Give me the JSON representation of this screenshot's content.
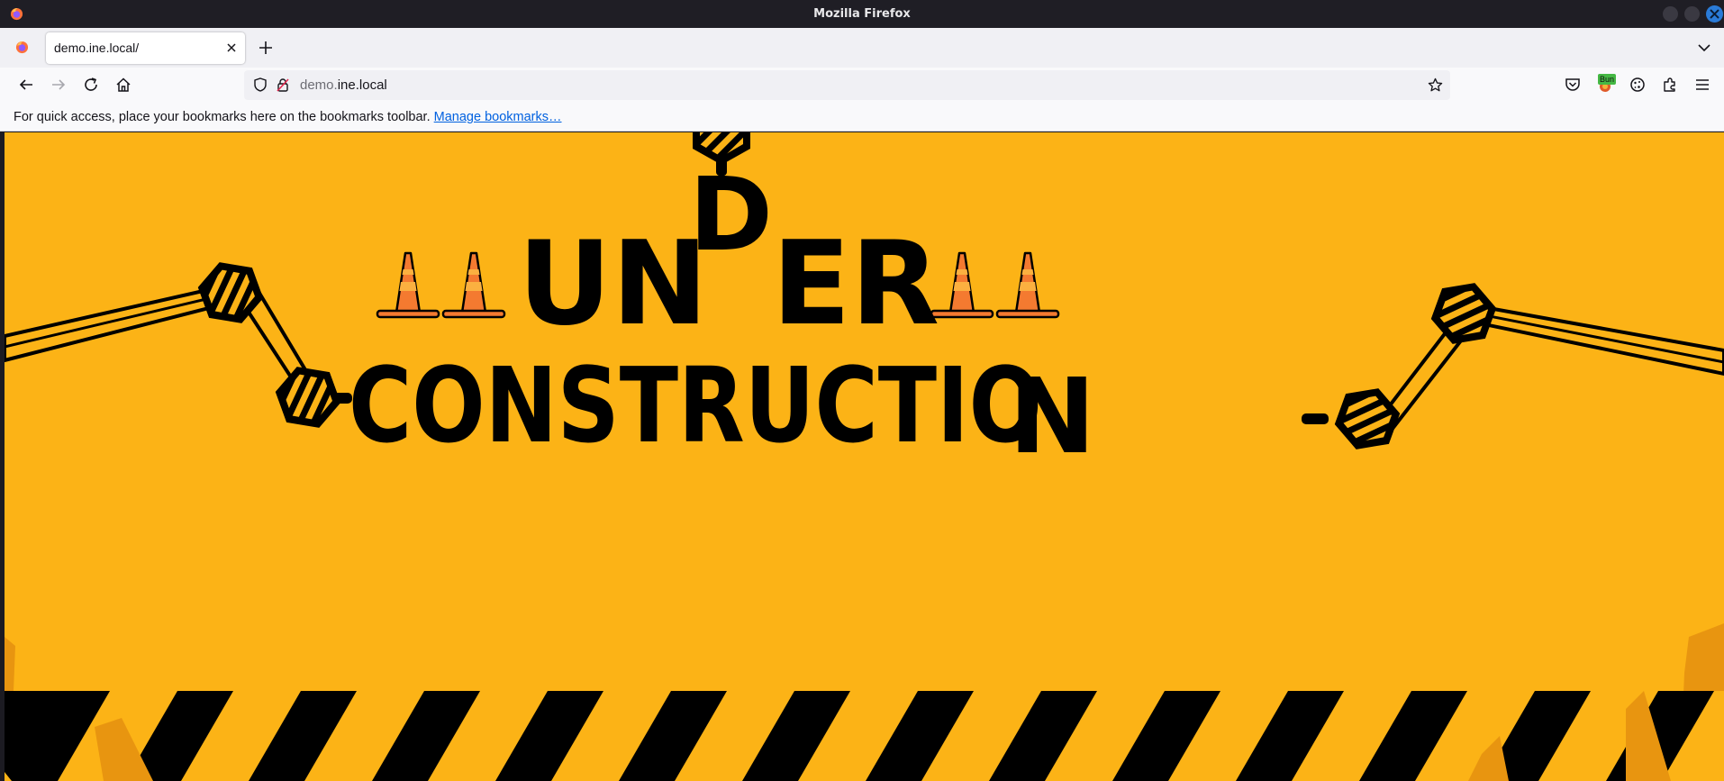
{
  "window": {
    "title": "Mozilla Firefox"
  },
  "tabs": [
    {
      "label": "demo.ine.local/"
    }
  ],
  "navbar": {
    "url_domain_prefix": "demo.",
    "url_domain_main": "ine.local",
    "extension_badge": "Bun"
  },
  "bookmarks_bar": {
    "message": "For quick access, place your bookmarks here on the bookmarks toolbar.",
    "manage_link": "Manage bookmarks…"
  },
  "page": {
    "headline_line1_left": "UN",
    "headline_line1_drop": "D",
    "headline_line1_right": "ER",
    "headline_line2": "CONSTRUCTIO",
    "headline_line2_last": "N",
    "colors": {
      "background": "#fcb316",
      "ink": "#000000",
      "cone_orange": "#f47a30",
      "cone_stripe": "#fbb040"
    }
  },
  "icons": {
    "app": "firefox-icon",
    "back": "arrow-left-icon",
    "forward": "arrow-right-icon",
    "reload": "reload-icon",
    "home": "home-icon",
    "tracking": "shield-icon",
    "connection": "lock-icon",
    "bookmark": "star-icon",
    "pocket": "pocket-icon",
    "extension": "extension-icon",
    "account": "cookie-icon",
    "extensions": "puzzle-icon",
    "menu": "hamburger-menu-icon"
  }
}
